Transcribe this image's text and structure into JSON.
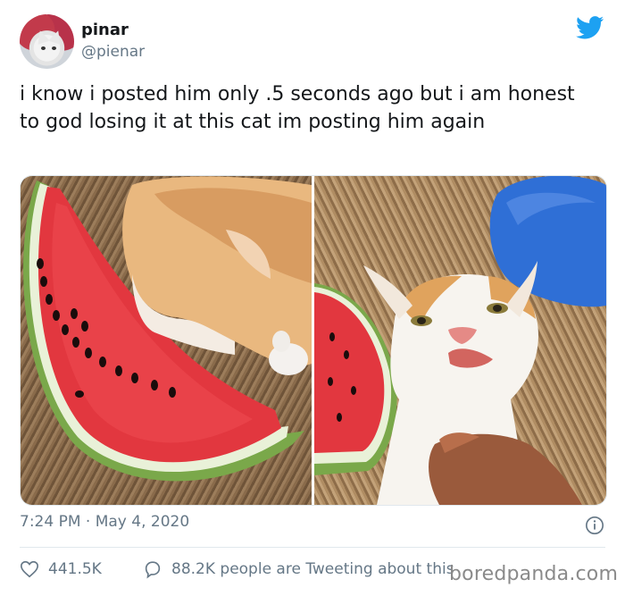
{
  "author": {
    "display_name": "pinar",
    "handle": "@pienar"
  },
  "brand": {
    "icon": "twitter-bird-icon",
    "color": "#1da1f2"
  },
  "tweet": {
    "text": "i know i posted him only .5 seconds ago but i am honest to god losing it at this cat im posting him again",
    "time": "7:24 PM",
    "separator": "·",
    "date": "May 4, 2020"
  },
  "media": [
    {
      "name": "cat-eating-watermelon-photo"
    },
    {
      "name": "cat-face-closeup-photo"
    }
  ],
  "stats": {
    "likes": "441.5K",
    "tweeting": "88.2K people are Tweeting about this"
  },
  "watermark": "boredpanda.com",
  "colors": {
    "text": "#14171a",
    "secondary": "#657786",
    "divider": "#e1e8ed"
  }
}
